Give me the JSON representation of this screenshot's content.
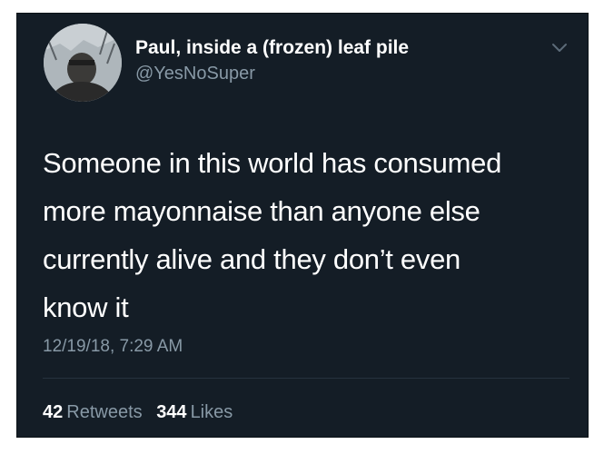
{
  "tweet": {
    "author": {
      "display_name": "Paul, inside a (frozen) leaf pile",
      "handle": "@YesNoSuper",
      "avatar_icon": "profile-photo"
    },
    "menu_icon": "chevron-down-icon",
    "text_lines": [
      "Someone in this world has consumed",
      "more mayonnaise than anyone else",
      "currently alive and they don’t even",
      "know it"
    ],
    "timestamp": "12/19/18, 7:29 AM",
    "stats": {
      "retweets_count": "42",
      "retweets_label": "Retweets",
      "likes_count": "344",
      "likes_label": "Likes"
    }
  },
  "colors": {
    "background": "#141d26",
    "primary_text": "#ffffff",
    "secondary_text": "#8899a6",
    "divider": "#26323e"
  }
}
